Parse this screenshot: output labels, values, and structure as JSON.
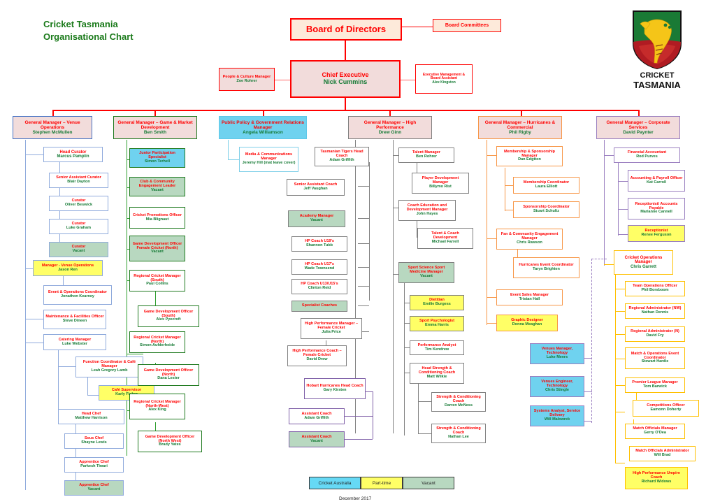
{
  "header": {
    "title_line1": "Cricket Tasmania",
    "title_line2": "Organisational Chart",
    "logo_line1": "CRICKET",
    "logo_line2": "TASMANIA"
  },
  "footer": {
    "date": "December 2017",
    "legend": [
      {
        "label": "Cricket Australia",
        "color": "#66d9f5"
      },
      {
        "label": "Part-time",
        "color": "#ffff66"
      },
      {
        "label": "Vacant",
        "color": "#b8d8c0"
      }
    ]
  },
  "top": {
    "board": {
      "title": "Board of Directors",
      "name": ""
    },
    "board_committees": {
      "title": "Board Committees",
      "name": ""
    },
    "chief_executive": {
      "title": "Chief Executive",
      "name": "Nick Cummins"
    },
    "people_culture": {
      "title": "People & Culture Manager",
      "name": "Zoe Rohrer"
    },
    "exec_assistant": {
      "title": "Executive Management & Board Assistant",
      "name": "Alex Kingston"
    }
  },
  "columns": [
    {
      "id": "venue-operations",
      "head": {
        "title": "General Manager – Venue Operations",
        "name": "Stephen McMullen"
      },
      "color": "#4472c4",
      "nodes": [
        {
          "title": "Head Curator",
          "name": "Marcus Pamplin"
        },
        {
          "title": "Senior Assistant Curator",
          "name": "Blair Dayton"
        },
        {
          "title": "Curator",
          "name": "Oliver Beswick"
        },
        {
          "title": "Curator",
          "name": "Luke Graham"
        },
        {
          "title": "Curator",
          "name": "Vacant"
        },
        {
          "title": "Manager - Venue Operations",
          "name": "Jason Ren"
        },
        {
          "title": "Event & Operations Coordinator",
          "name": "Jonathon Kearney"
        },
        {
          "title": "Maintenance & Facilities Officer",
          "name": "Steve Dineen"
        },
        {
          "title": "Catering Manager",
          "name": "Luke Webster"
        },
        {
          "title": "Function Coordinator & Café Manager",
          "name": "Leah Gregory Lamb"
        },
        {
          "title": "Café Supervisor",
          "name": "Karly Fisher"
        },
        {
          "title": "Head Chef",
          "name": "Matthew Harrison"
        },
        {
          "title": "Sous Chef",
          "name": "Shayne Lewis"
        },
        {
          "title": "Apprentice Chef",
          "name": "Parkesh Tiwari"
        },
        {
          "title": "Apprentice Chef",
          "name": "Vacant"
        }
      ]
    },
    {
      "id": "game-market-development",
      "head": {
        "title": "General Manager – Game & Market Development",
        "name": "Ben Smith"
      },
      "color": "#1f7a1f",
      "nodes": [
        {
          "title": "Junior Participation Specialist",
          "name": "Simon Terhell"
        },
        {
          "title": "Club & Community Engagement Leader",
          "name": "Vacant"
        },
        {
          "title": "Cricket Promotions Officer",
          "name": "Mia Blignaut"
        },
        {
          "title": "Game Development Officer Female Cricket (North)",
          "name": "Vacant"
        },
        {
          "title": "Regional Cricket Manager (South)",
          "name": "Paul Collins"
        },
        {
          "title": "Game Development Officer (South)",
          "name": "Alex Pyecroft"
        },
        {
          "title": "Regional Cricket Manager (North)",
          "name": "Simon Aufderheide"
        },
        {
          "title": "Game Development Officer (North)",
          "name": "Dana Lester"
        },
        {
          "title": "Regional Cricket Manager (North-West)",
          "name": "Alex King"
        },
        {
          "title": "Game Development Officer (North West)",
          "name": "Brady Yates"
        }
      ]
    },
    {
      "id": "public-policy",
      "head": {
        "title": "Public Policy & Government Relations Manager",
        "name": "Angela Williamson"
      },
      "color": "#5fc8e8",
      "nodes": [
        {
          "title": "Media & Communications Manager",
          "name": "Jeremy Hill (mat leave cover)"
        }
      ]
    },
    {
      "id": "high-performance",
      "head": {
        "title": "General Manager – High Performance",
        "name": "Drew Ginn"
      },
      "color": "#808080",
      "nodes": [
        {
          "title": "Tasmanian Tigers Head Coach",
          "name": "Adam Griffith"
        },
        {
          "title": "Senior Assistant Coach",
          "name": "Jeff Vaughan"
        },
        {
          "title": "Academy Manager",
          "name": "Vacant"
        },
        {
          "title": "HP Coach U19's",
          "name": "Shannon Tubb"
        },
        {
          "title": "HP Coach U17's",
          "name": "Wade Townsend"
        },
        {
          "title": "HP Coach U13/U15's",
          "name": "Clinton Reid"
        },
        {
          "title": "Specialist Coaches",
          "name": ""
        },
        {
          "title": "High Performance Manager – Female Cricket",
          "name": "Julia Price"
        },
        {
          "title": "High Performance Coach – Female Cricket",
          "name": "David Drew"
        },
        {
          "title": "Hobart Hurricanes Head Coach",
          "name": "Gary Kirsten"
        },
        {
          "title": "Assistant Coach",
          "name": "Adam Griffith"
        },
        {
          "title": "Assistant Coach",
          "name": "Vacant"
        },
        {
          "title": "Talent Manager",
          "name": "Ben Rohrer"
        },
        {
          "title": "Player Development Manager",
          "name": "Billymo Rist"
        },
        {
          "title": "Coach Education and Development Manager",
          "name": "John Hayes"
        },
        {
          "title": "Talent & Coach Development",
          "name": "Michael Farrell"
        },
        {
          "title": "Sport Science Sport Medicine Manager",
          "name": "Vacant"
        },
        {
          "title": "Dietitian",
          "name": "Emilie Burgess"
        },
        {
          "title": "Sport Psychologist",
          "name": "Emma Harris"
        },
        {
          "title": "Performance Analyst",
          "name": "Tim Kendrew"
        },
        {
          "title": "Head Strength & Conditioning Coach",
          "name": "Matt Wilkie"
        },
        {
          "title": "Strength & Conditioning Coach",
          "name": "Darren McNess"
        },
        {
          "title": "Strength & Conditioning Coach",
          "name": "Nathan Lee"
        }
      ]
    },
    {
      "id": "hurricanes-commercial",
      "head": {
        "title": "General Manager – Hurricanes & Commercial",
        "name": "Phil Rigby"
      },
      "color": "#f79646",
      "nodes": [
        {
          "title": "Membership & Sponsorship Manager",
          "name": "Dan Edgtton"
        },
        {
          "title": "Membership Coordinator",
          "name": "Laura Elliott"
        },
        {
          "title": "Sponsorship Coordinator",
          "name": "Stuart Schultz"
        },
        {
          "title": "Fan & Community Engagement Manager",
          "name": "Chris Rawson"
        },
        {
          "title": "Hurricanes Event Coordinator",
          "name": "Taryn Brighten"
        },
        {
          "title": "Event Sales Manager",
          "name": "Tristan Hall"
        },
        {
          "title": "Graphic Designer",
          "name": "Donna Meaghan"
        },
        {
          "title": "Venues Manager, Technology",
          "name": "Luke Meers"
        },
        {
          "title": "Venues Engineer, Technology",
          "name": "Chris Stingle"
        },
        {
          "title": "Systems Analyst, Service Delivery",
          "name": "Will Malowrek"
        }
      ]
    },
    {
      "id": "corporate-services",
      "head": {
        "title": "General Manager – Corporate Services",
        "name": "David Paynter"
      },
      "color": "#9a7fc0",
      "nodes": [
        {
          "title": "Financial Accountant",
          "name": "Rod Purves"
        },
        {
          "title": "Accounting & Payroll Officer",
          "name": "Kat Carroll"
        },
        {
          "title": "Receptionist/ Accounts Payable",
          "name": "Marianne Cannell"
        },
        {
          "title": "Receptionist",
          "name": "Renee Ferguson"
        },
        {
          "title": "Cricket Operations Manager",
          "name": "Chris Garrett"
        },
        {
          "title": "Team Operations Officer",
          "name": "Phil Borsboom"
        },
        {
          "title": "Regional Administrator (NW)",
          "name": "Nathan Dennis"
        },
        {
          "title": "Regional Administrator (N)",
          "name": "David Fry"
        },
        {
          "title": "Match & Operations Event Coordinator",
          "name": "Stewart Hardie"
        },
        {
          "title": "Premier League Manager",
          "name": "Tom Barwick"
        },
        {
          "title": "Competitions Officer",
          "name": "Eamonn Doherty"
        },
        {
          "title": "Match Officials Manager",
          "name": "Gerry O'Dea"
        },
        {
          "title": "Match Officials Administrator",
          "name": "Will Brad"
        },
        {
          "title": "High Performance Umpire Coach",
          "name": "Richard Widows"
        }
      ]
    }
  ]
}
